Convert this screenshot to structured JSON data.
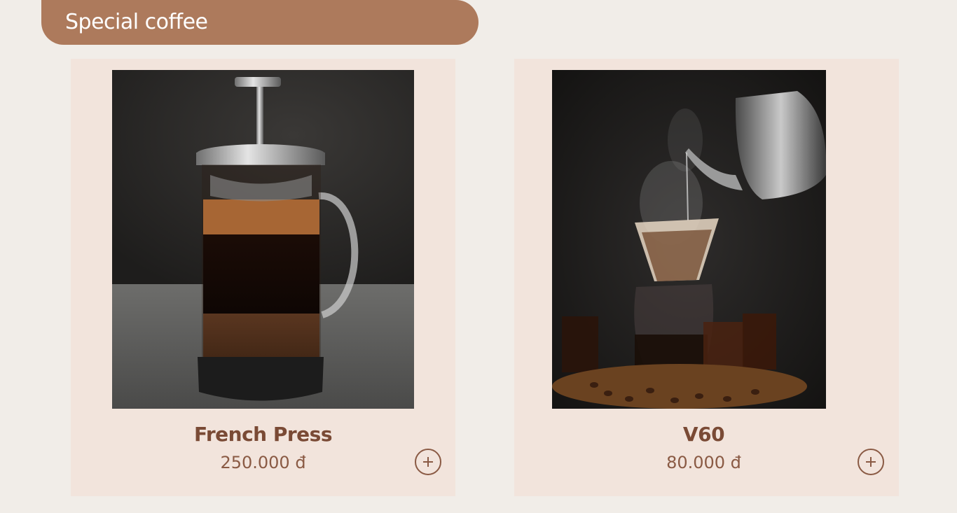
{
  "section": {
    "title": "Special coffee"
  },
  "products": [
    {
      "name": "French Press",
      "price": "250.000 đ",
      "image_icon": "french-press-image"
    },
    {
      "name": "V60",
      "price": "80.000 đ",
      "image_icon": "v60-pour-over-image"
    }
  ],
  "colors": {
    "background": "#f1ede8",
    "header": "#ad7a5c",
    "card": "#f2e4dc",
    "text_brown": "#7a4a35"
  }
}
